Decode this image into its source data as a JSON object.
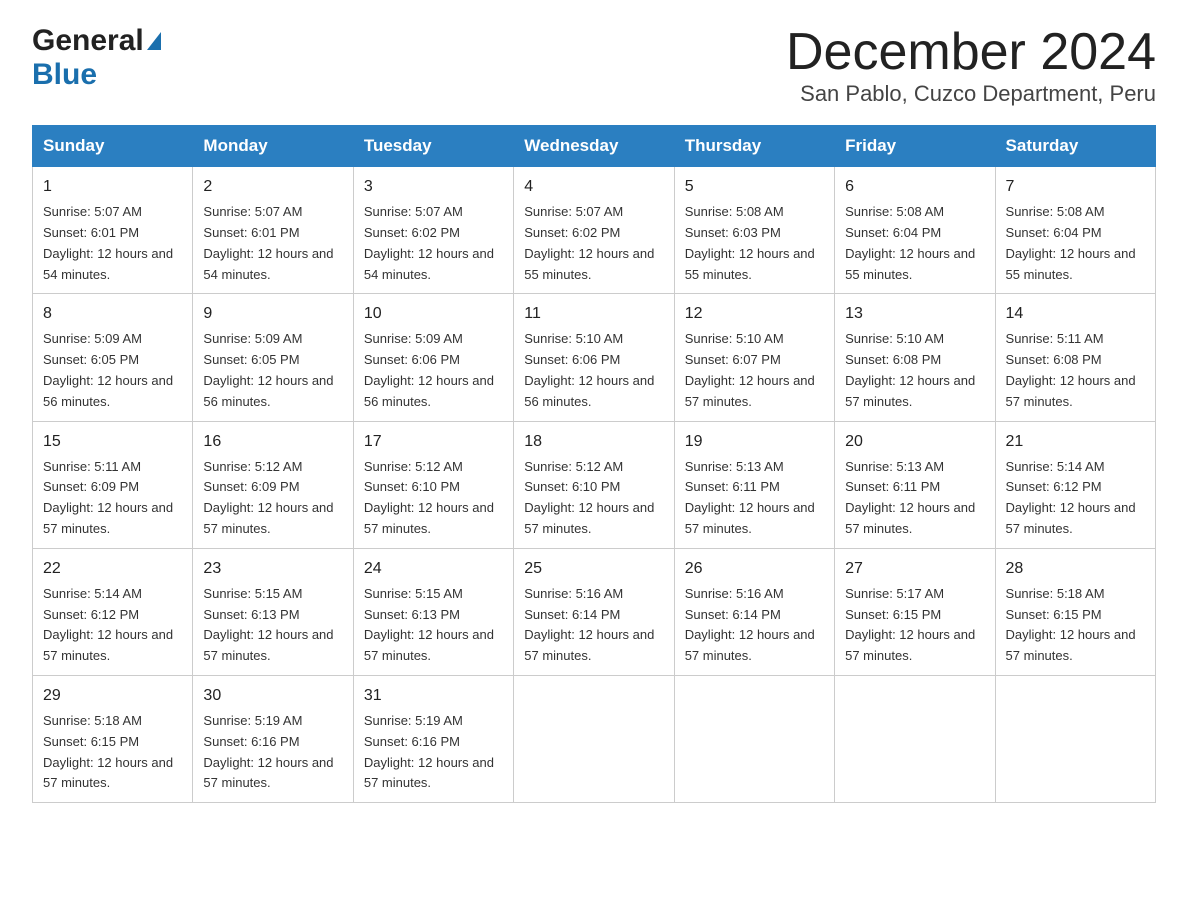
{
  "header": {
    "logo_general": "General",
    "logo_blue": "Blue",
    "title": "December 2024",
    "subtitle": "San Pablo, Cuzco Department, Peru"
  },
  "days_of_week": [
    "Sunday",
    "Monday",
    "Tuesday",
    "Wednesday",
    "Thursday",
    "Friday",
    "Saturday"
  ],
  "weeks": [
    [
      {
        "num": "1",
        "sunrise": "5:07 AM",
        "sunset": "6:01 PM",
        "daylight": "12 hours and 54 minutes."
      },
      {
        "num": "2",
        "sunrise": "5:07 AM",
        "sunset": "6:01 PM",
        "daylight": "12 hours and 54 minutes."
      },
      {
        "num": "3",
        "sunrise": "5:07 AM",
        "sunset": "6:02 PM",
        "daylight": "12 hours and 54 minutes."
      },
      {
        "num": "4",
        "sunrise": "5:07 AM",
        "sunset": "6:02 PM",
        "daylight": "12 hours and 55 minutes."
      },
      {
        "num": "5",
        "sunrise": "5:08 AM",
        "sunset": "6:03 PM",
        "daylight": "12 hours and 55 minutes."
      },
      {
        "num": "6",
        "sunrise": "5:08 AM",
        "sunset": "6:04 PM",
        "daylight": "12 hours and 55 minutes."
      },
      {
        "num": "7",
        "sunrise": "5:08 AM",
        "sunset": "6:04 PM",
        "daylight": "12 hours and 55 minutes."
      }
    ],
    [
      {
        "num": "8",
        "sunrise": "5:09 AM",
        "sunset": "6:05 PM",
        "daylight": "12 hours and 56 minutes."
      },
      {
        "num": "9",
        "sunrise": "5:09 AM",
        "sunset": "6:05 PM",
        "daylight": "12 hours and 56 minutes."
      },
      {
        "num": "10",
        "sunrise": "5:09 AM",
        "sunset": "6:06 PM",
        "daylight": "12 hours and 56 minutes."
      },
      {
        "num": "11",
        "sunrise": "5:10 AM",
        "sunset": "6:06 PM",
        "daylight": "12 hours and 56 minutes."
      },
      {
        "num": "12",
        "sunrise": "5:10 AM",
        "sunset": "6:07 PM",
        "daylight": "12 hours and 57 minutes."
      },
      {
        "num": "13",
        "sunrise": "5:10 AM",
        "sunset": "6:08 PM",
        "daylight": "12 hours and 57 minutes."
      },
      {
        "num": "14",
        "sunrise": "5:11 AM",
        "sunset": "6:08 PM",
        "daylight": "12 hours and 57 minutes."
      }
    ],
    [
      {
        "num": "15",
        "sunrise": "5:11 AM",
        "sunset": "6:09 PM",
        "daylight": "12 hours and 57 minutes."
      },
      {
        "num": "16",
        "sunrise": "5:12 AM",
        "sunset": "6:09 PM",
        "daylight": "12 hours and 57 minutes."
      },
      {
        "num": "17",
        "sunrise": "5:12 AM",
        "sunset": "6:10 PM",
        "daylight": "12 hours and 57 minutes."
      },
      {
        "num": "18",
        "sunrise": "5:12 AM",
        "sunset": "6:10 PM",
        "daylight": "12 hours and 57 minutes."
      },
      {
        "num": "19",
        "sunrise": "5:13 AM",
        "sunset": "6:11 PM",
        "daylight": "12 hours and 57 minutes."
      },
      {
        "num": "20",
        "sunrise": "5:13 AM",
        "sunset": "6:11 PM",
        "daylight": "12 hours and 57 minutes."
      },
      {
        "num": "21",
        "sunrise": "5:14 AM",
        "sunset": "6:12 PM",
        "daylight": "12 hours and 57 minutes."
      }
    ],
    [
      {
        "num": "22",
        "sunrise": "5:14 AM",
        "sunset": "6:12 PM",
        "daylight": "12 hours and 57 minutes."
      },
      {
        "num": "23",
        "sunrise": "5:15 AM",
        "sunset": "6:13 PM",
        "daylight": "12 hours and 57 minutes."
      },
      {
        "num": "24",
        "sunrise": "5:15 AM",
        "sunset": "6:13 PM",
        "daylight": "12 hours and 57 minutes."
      },
      {
        "num": "25",
        "sunrise": "5:16 AM",
        "sunset": "6:14 PM",
        "daylight": "12 hours and 57 minutes."
      },
      {
        "num": "26",
        "sunrise": "5:16 AM",
        "sunset": "6:14 PM",
        "daylight": "12 hours and 57 minutes."
      },
      {
        "num": "27",
        "sunrise": "5:17 AM",
        "sunset": "6:15 PM",
        "daylight": "12 hours and 57 minutes."
      },
      {
        "num": "28",
        "sunrise": "5:18 AM",
        "sunset": "6:15 PM",
        "daylight": "12 hours and 57 minutes."
      }
    ],
    [
      {
        "num": "29",
        "sunrise": "5:18 AM",
        "sunset": "6:15 PM",
        "daylight": "12 hours and 57 minutes."
      },
      {
        "num": "30",
        "sunrise": "5:19 AM",
        "sunset": "6:16 PM",
        "daylight": "12 hours and 57 minutes."
      },
      {
        "num": "31",
        "sunrise": "5:19 AM",
        "sunset": "6:16 PM",
        "daylight": "12 hours and 57 minutes."
      },
      null,
      null,
      null,
      null
    ]
  ]
}
